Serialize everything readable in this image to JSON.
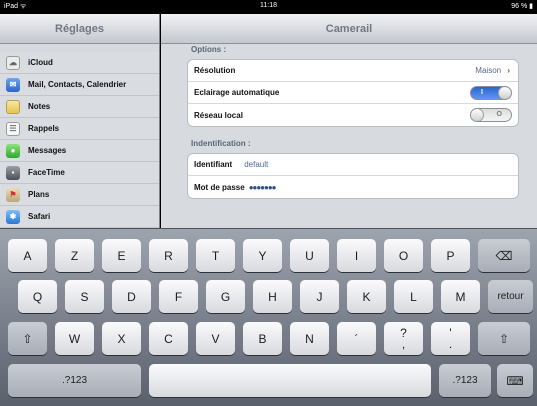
{
  "status_bar": {
    "device": "iPad ᯤ",
    "time": "11:18",
    "battery": "96 % ▮"
  },
  "sidebar": {
    "title": "Réglages",
    "items": [
      {
        "label": "iCloud",
        "icon": "cloud-icon",
        "color": "#e8e8e8"
      },
      {
        "label": "Mail, Contacts, Calendrier",
        "icon": "mail-icon",
        "color": "#3d7ad6"
      },
      {
        "label": "Notes",
        "icon": "notes-icon",
        "color": "#f2d66c"
      },
      {
        "label": "Rappels",
        "icon": "reminders-icon",
        "color": "#f4f4f4"
      },
      {
        "label": "Messages",
        "icon": "messages-icon",
        "color": "#53c552"
      },
      {
        "label": "FaceTime",
        "icon": "facetime-icon",
        "color": "#6b7078"
      },
      {
        "label": "Plans",
        "icon": "maps-icon",
        "color": "#d6c49b"
      },
      {
        "label": "Safari",
        "icon": "safari-icon",
        "color": "#3a8de0"
      }
    ]
  },
  "detail": {
    "title": "Camerail",
    "options_label": "Options :",
    "resolution": {
      "label": "Résolution",
      "value": "Maison",
      "chevron": "›"
    },
    "auto_light": {
      "label": "Eclairage automatique",
      "on": true,
      "mark": "I"
    },
    "local_network": {
      "label": "Réseau local",
      "on": false,
      "mark": "O"
    },
    "ident_label": "Indentification :",
    "identifier": {
      "label": "Identifiant",
      "value": "default"
    },
    "password": {
      "label": "Mot de passe",
      "value": "●●●●●●●"
    }
  },
  "keyboard": {
    "row1": [
      "A",
      "Z",
      "E",
      "R",
      "T",
      "Y",
      "U",
      "I",
      "O",
      "P"
    ],
    "row2": [
      "Q",
      "S",
      "D",
      "F",
      "G",
      "H",
      "J",
      "K",
      "L",
      "M"
    ],
    "row3": [
      "W",
      "X",
      "C",
      "V",
      "B",
      "N",
      "´"
    ],
    "question": {
      "top": "?",
      "bottom": ","
    },
    "period": {
      "top": "'",
      "bottom": "."
    },
    "backspace": "⌫",
    "return": "retour",
    "shift": "⇧",
    "numbers": ".?123",
    "hide": "⌨"
  }
}
